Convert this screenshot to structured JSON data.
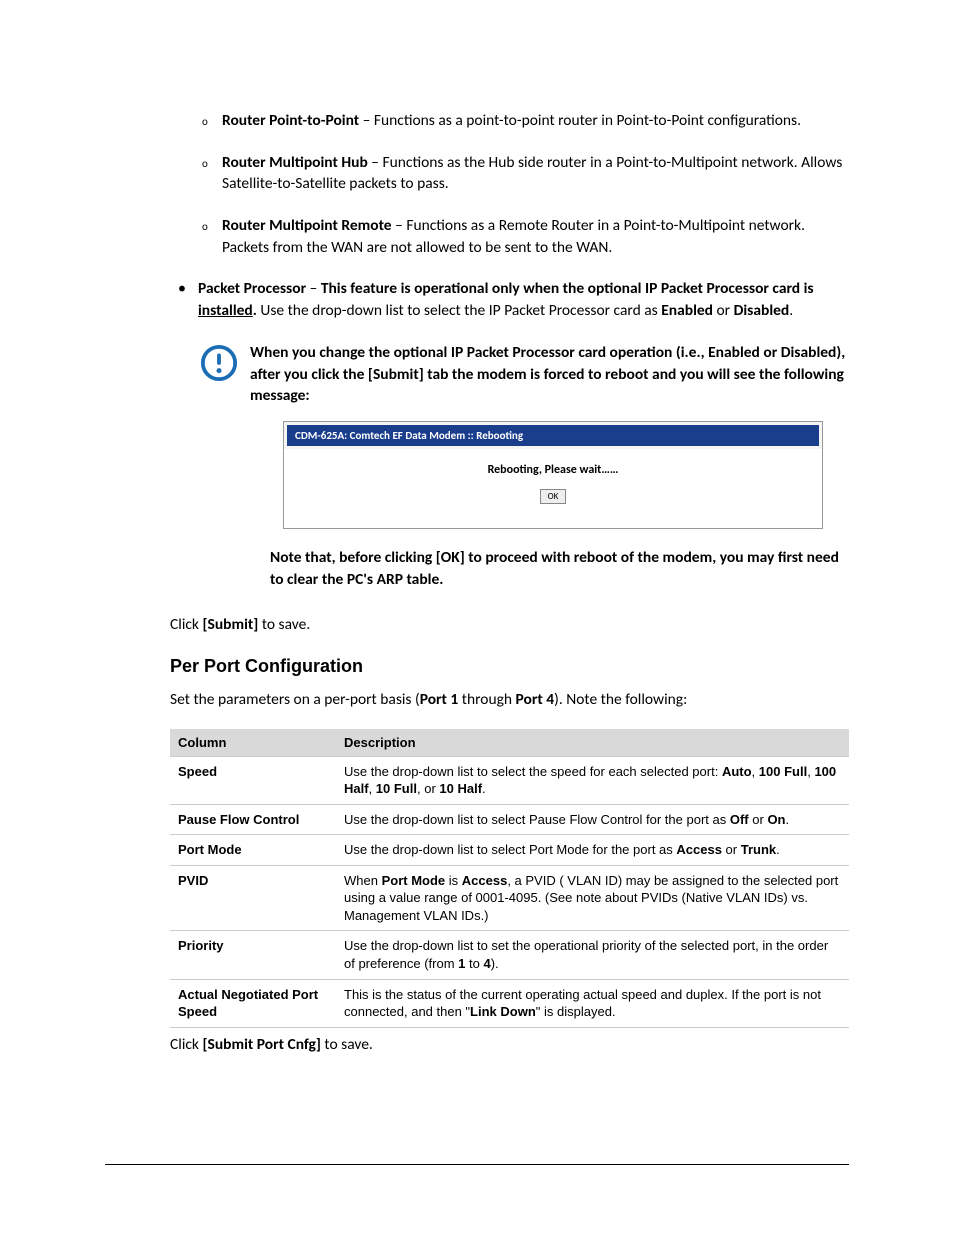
{
  "sub_bullets": [
    {
      "term": "Router Point-to-Point",
      "desc": " – Functions as a point-to-point router in Point-to-Point configurations."
    },
    {
      "term": "Router Multipoint Hub",
      "desc": " – Functions as the Hub side router in a Point-to-Multipoint network. Allows Satellite-to-Satellite packets to pass."
    },
    {
      "term": "Router Multipoint Remote",
      "desc": " – Functions as a Remote Router in a Point-to-Multipoint network. Packets from the WAN are not allowed to be sent to the WAN."
    }
  ],
  "packet_proc": {
    "label": "Packet Processor",
    "pre": "This feature is operational only when the optional IP Packet Processor card is ",
    "installed": "installed",
    "after_installed": ".",
    "mid": " Use the drop-down list to select the IP Packet Processor card as ",
    "opt1": "Enabled",
    "or": " or ",
    "opt2": "Disabled",
    "end": "."
  },
  "alert_note": "When you change the optional IP Packet Processor card operation (i.e., Enabled or Disabled), after you click the [Submit] tab the modem is forced to reboot and you will see the following message:",
  "screenshot": {
    "title": "CDM-625A:  Comtech EF Data Modem :: Rebooting",
    "msg": "Rebooting, Please wait……",
    "ok": "OK"
  },
  "post_note": "Note that, before clicking [OK] to proceed with reboot of the modem, you may first need to clear the PC's ARP table.",
  "click_submit_1": "Click ",
  "click_submit_2": "[Submit]",
  "click_submit_3": " to save.",
  "section_heading": "Per Port Configuration",
  "per_port_intro_1": "Set the parameters on a per-port basis (",
  "per_port_intro_2": "Port 1",
  "per_port_intro_3": " through ",
  "per_port_intro_4": "Port 4",
  "per_port_intro_5": "). Note the following:",
  "table": {
    "header": {
      "c1": "Column",
      "c2": "Description"
    },
    "rows": [
      {
        "label": "Speed",
        "pre": "Use the drop-down list to select the speed for each selected port: ",
        "bold": [
          "Auto",
          "100 Full",
          "100 Half",
          "10 Full",
          "10 Half"
        ],
        "seps": [
          ", ",
          ", ",
          ", ",
          ", or ",
          "."
        ]
      },
      {
        "label": "Pause Flow Control",
        "pre": "Use the drop-down list to select Pause Flow Control for the port as ",
        "bold": [
          "Off",
          "On"
        ],
        "seps": [
          " or ",
          "."
        ]
      },
      {
        "label": "Port Mode",
        "pre": "Use the drop-down list to select Port Mode for the port as ",
        "bold": [
          "Access",
          "Trunk"
        ],
        "seps": [
          " or ",
          "."
        ]
      },
      {
        "label": "PVID",
        "pre": "When ",
        "bold": [
          "Port Mode"
        ],
        "mid": " is ",
        "bold2": [
          "Access"
        ],
        "post": ", a PVID (         VLAN ID) may be assigned to the selected port using a value range of 0001-4095. (See note about PVIDs (Native VLAN IDs) vs. Management VLAN IDs.)"
      },
      {
        "label": "Priority",
        "pre": "Use the drop-down list to set the operational priority of the selected port, in the order of preference (from ",
        "bold": [
          "1"
        ],
        "mid": " to ",
        "bold2": [
          "4"
        ],
        "post": ")."
      },
      {
        "label": "Actual Negotiated Port Speed",
        "pre": "This is the status of the current operating actual speed and duplex. If the port is not connected, and then \"",
        "bold": [
          "Link Down"
        ],
        "post": "\" is displayed."
      }
    ]
  },
  "click_cnfg_1": "Click ",
  "click_cnfg_2": "[Submit Port Cnfg]",
  "click_cnfg_3": " to save."
}
